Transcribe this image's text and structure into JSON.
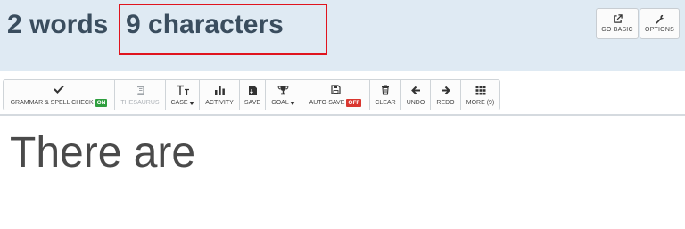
{
  "counts": {
    "words": "2 words",
    "characters": "9 characters"
  },
  "header_buttons": {
    "go_basic": {
      "label": "GO BASIC",
      "icon": "external-link-icon"
    },
    "options": {
      "label": "OPTIONS",
      "icon": "wrench-icon"
    }
  },
  "toolbar": {
    "grammar": {
      "label": "GRAMMAR & SPELL CHECK",
      "badge": "ON",
      "icon": "checkmark-icon"
    },
    "thesaurus": {
      "label": "THESAURUS",
      "icon": "book-icon",
      "disabled": true
    },
    "case": {
      "label": "CASE",
      "icon": "text-case-icon"
    },
    "activity": {
      "label": "ACTIVITY",
      "icon": "bar-chart-icon"
    },
    "save": {
      "label": "SAVE",
      "icon": "save-file-icon"
    },
    "goal": {
      "label": "GOAL",
      "icon": "trophy-icon"
    },
    "autosave": {
      "label": "AUTO-SAVE",
      "badge": "OFF",
      "icon": "floppy-disk-icon"
    },
    "clear": {
      "label": "CLEAR",
      "icon": "trash-icon"
    },
    "undo": {
      "label": "UNDO",
      "icon": "arrow-left-icon"
    },
    "redo": {
      "label": "REDO",
      "icon": "arrow-right-icon"
    },
    "more": {
      "label": "MORE (9)",
      "icon": "grid-icon"
    }
  },
  "editor": {
    "text": "There are"
  },
  "colors": {
    "header_bg": "#dfeaf3",
    "count_text": "#3a4d5e",
    "highlight": "#e0141e",
    "badge_on": "#2e9e3e",
    "badge_off": "#d9362f"
  }
}
